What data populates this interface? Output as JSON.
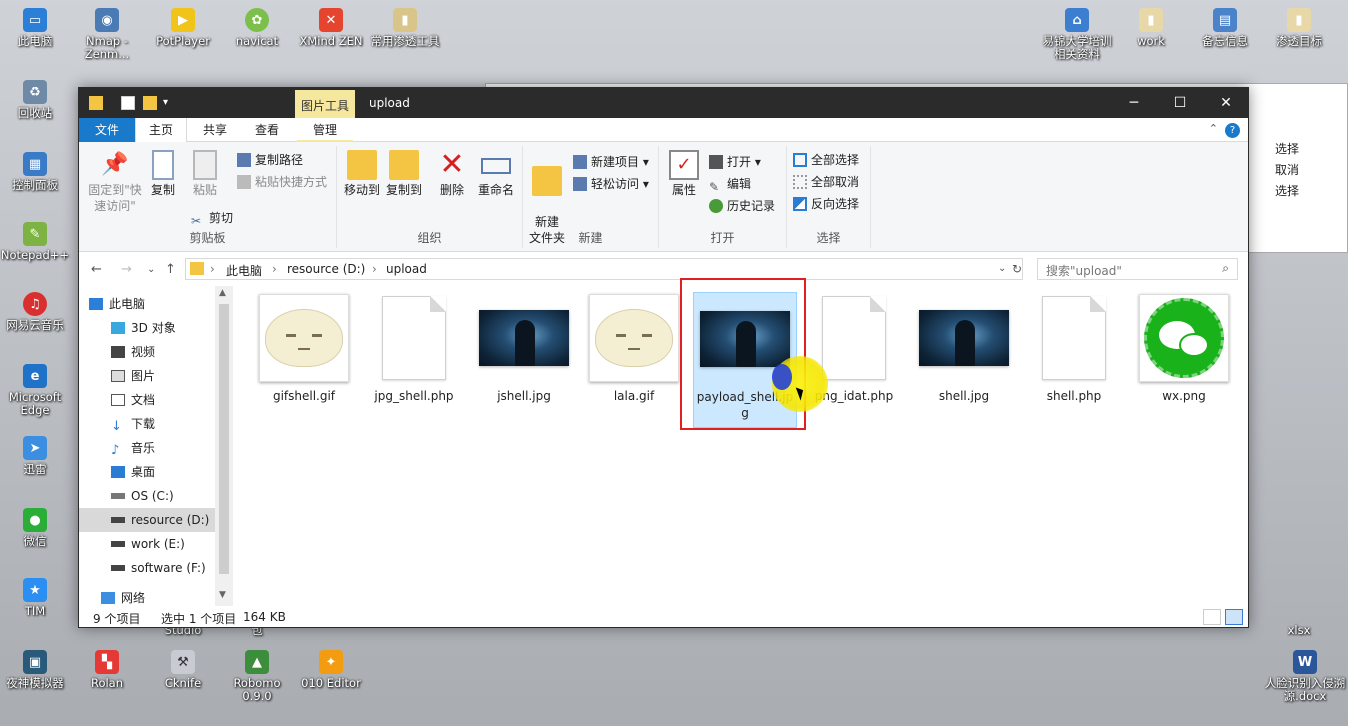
{
  "desktop": {
    "icons_left": [
      "此电脑",
      "回收站",
      "控制面板",
      "Notepad++",
      "网易云音乐",
      "Microsoft Edge",
      "迅雷",
      "微信",
      "TIM",
      "夜神模拟器"
    ],
    "icons_top": [
      "Nmap - Zenm...",
      "PotPlayer",
      "navicat",
      "XMind ZEN",
      "常用渗透工具"
    ],
    "icons_bottom": [
      "Rolan",
      "Cknife",
      "Robomo 0.9.0",
      "010 Editor"
    ],
    "icons_right": [
      "易锦大学培训相关资料",
      "work",
      "备忘信息",
      "渗透目标"
    ],
    "partial_labels": [
      "Studio",
      "包",
      "xlsx",
      "人脸识别入侵溯源.docx"
    ]
  },
  "bg_window": {
    "items": [
      "选择",
      "取消",
      "选择"
    ]
  },
  "window": {
    "context_tab": "图片工具",
    "title": "upload",
    "controls": {
      "minimize": "─",
      "maximize": "☐",
      "close": "✕"
    }
  },
  "tabs": {
    "file": "文件",
    "home": "主页",
    "share": "共享",
    "view": "查看",
    "manage": "管理"
  },
  "ribbon": {
    "clipboard": {
      "pin": "固定到\"快速访问\"",
      "copy": "复制",
      "paste": "粘贴",
      "copy_path": "复制路径",
      "paste_shortcut": "粘贴快捷方式",
      "cut": "剪切",
      "name": "剪贴板"
    },
    "organize": {
      "move_to": "移动到",
      "copy_to": "复制到",
      "delete": "删除",
      "rename": "重命名",
      "name": "组织"
    },
    "new": {
      "new_folder": "新建\n文件夹",
      "new_item": "新建项目",
      "easy_access": "轻松访问",
      "name": "新建"
    },
    "open": {
      "properties": "属性",
      "open": "打开",
      "edit": "编辑",
      "history": "历史记录",
      "name": "打开"
    },
    "select": {
      "select_all": "全部选择",
      "select_none": "全部取消",
      "invert": "反向选择",
      "name": "选择"
    }
  },
  "address": {
    "crumbs": [
      "此电脑",
      "resource (D:)",
      "upload"
    ],
    "search_placeholder": "搜索\"upload\""
  },
  "nav_pane": {
    "items": [
      "此电脑",
      "3D 对象",
      "视频",
      "图片",
      "文档",
      "下载",
      "音乐",
      "桌面",
      "OS (C:)",
      "resource (D:)",
      "work (E:)",
      "software (F:)",
      "网络"
    ]
  },
  "files": [
    {
      "name": "gifshell.gif",
      "kind": "gif"
    },
    {
      "name": "jpg_shell.php",
      "kind": "doc"
    },
    {
      "name": "jshell.jpg",
      "kind": "jpg"
    },
    {
      "name": "lala.gif",
      "kind": "gif"
    },
    {
      "name": "payload_shell.jpg",
      "kind": "jpg",
      "selected": true
    },
    {
      "name": "png_idat.php",
      "kind": "doc"
    },
    {
      "name": "shell.jpg",
      "kind": "jpg"
    },
    {
      "name": "shell.php",
      "kind": "doc"
    },
    {
      "name": "wx.png",
      "kind": "wx"
    }
  ],
  "status": {
    "count": "9 个项目",
    "selected": "选中 1 个项目",
    "size": "164 KB"
  },
  "colors": {
    "accent": "#1979ca",
    "titlebar": "#2b2b2b",
    "selection": "#cce8ff",
    "highlight_box": "#e02020",
    "context_tab": "#f5e79d"
  }
}
